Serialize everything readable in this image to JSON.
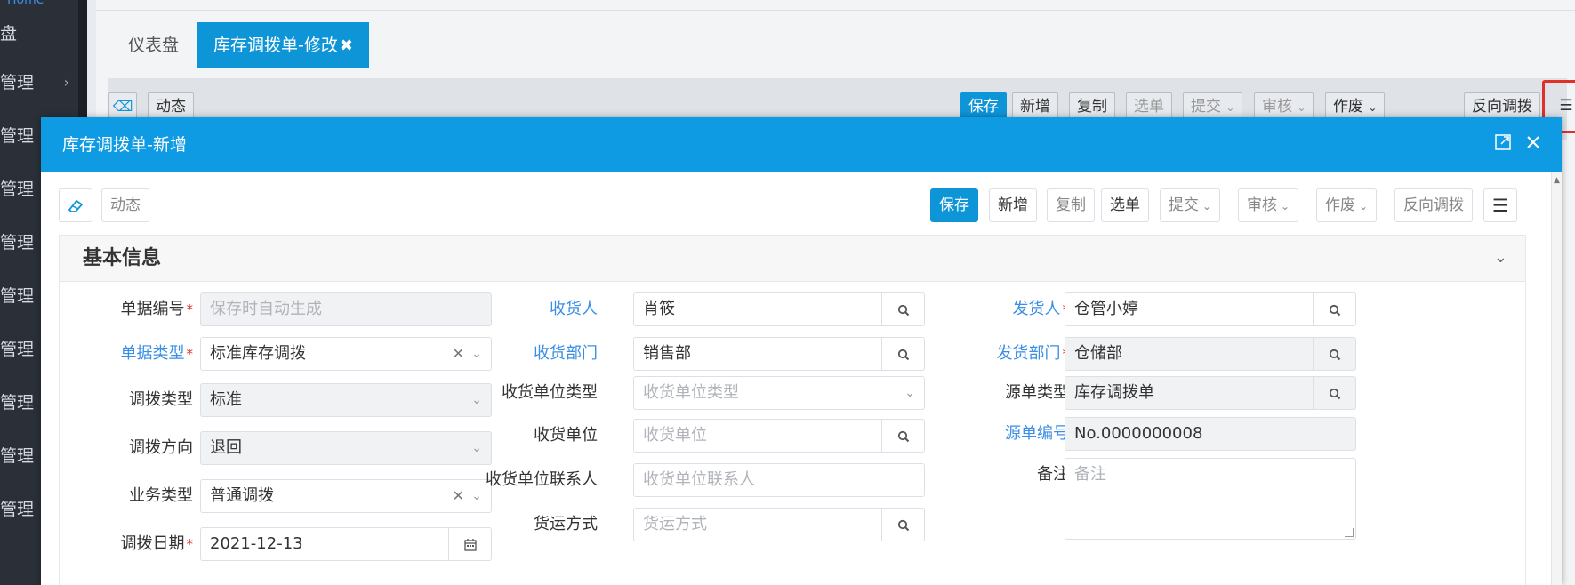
{
  "sidebar": {
    "home": "Home",
    "items": [
      {
        "label": "盘"
      },
      {
        "label": "管理",
        "has_arrow": true
      },
      {
        "label": "管理"
      },
      {
        "label": "管理"
      },
      {
        "label": "管理"
      },
      {
        "label": "管理"
      },
      {
        "label": "管理"
      },
      {
        "label": "管理"
      },
      {
        "label": "管理"
      },
      {
        "label": "管理"
      }
    ]
  },
  "background_page": {
    "tabs": [
      {
        "label": "仪表盘"
      },
      {
        "label": "库存调拨单-修改",
        "close": "✖"
      }
    ],
    "toolbar": {
      "dynamic": "动态",
      "save": "保存",
      "new": "新增",
      "copy": "复制",
      "select": "选单",
      "submit": "提交",
      "audit": "审核",
      "void": "作废",
      "reverse": "反向调拨"
    }
  },
  "modal": {
    "title": "库存调拨单-新增",
    "toolbar": {
      "dynamic": "动态",
      "save": "保存",
      "new": "新增",
      "copy": "复制",
      "select": "选单",
      "submit": "提交",
      "audit": "审核",
      "void": "作废",
      "reverse": "反向调拨"
    },
    "section_title": "基本信息",
    "form": {
      "doc_no": {
        "label": "单据编号",
        "placeholder": "保存时自动生成"
      },
      "doc_type": {
        "label": "单据类型",
        "value": "标准库存调拨"
      },
      "transfer_type": {
        "label": "调拨类型",
        "value": "标准"
      },
      "transfer_direction": {
        "label": "调拨方向",
        "value": "退回"
      },
      "business_type": {
        "label": "业务类型",
        "value": "普通调拨"
      },
      "transfer_date": {
        "label": "调拨日期",
        "value": "2021-12-13"
      },
      "receiver": {
        "label": "收货人",
        "value": "肖筱"
      },
      "receiving_dept": {
        "label": "收货部门",
        "value": "销售部"
      },
      "receiving_unit_type": {
        "label": "收货单位类型",
        "placeholder": "收货单位类型"
      },
      "receiving_unit": {
        "label": "收货单位",
        "placeholder": "收货单位"
      },
      "receiving_unit_contact": {
        "label": "收货单位联系人",
        "placeholder": "收货单位联系人"
      },
      "shipping_method": {
        "label": "货运方式",
        "placeholder": "货运方式"
      },
      "shipper": {
        "label": "发货人",
        "value": "仓管小婷"
      },
      "shipping_dept": {
        "label": "发货部门",
        "value": "仓储部"
      },
      "source_doc_type": {
        "label": "源单类型",
        "value": "库存调拨单"
      },
      "source_doc_no": {
        "label": "源单编号",
        "value": "No.0000000008"
      },
      "remark": {
        "label": "备注",
        "placeholder": "备注"
      }
    }
  },
  "colors": {
    "primary": "#0e95d8",
    "header": "#0e9be3",
    "link_label": "#3a8ee6",
    "required": "#e0302a",
    "highlight_box": "#e0302a",
    "sidebar_bg": "#2b3038"
  }
}
